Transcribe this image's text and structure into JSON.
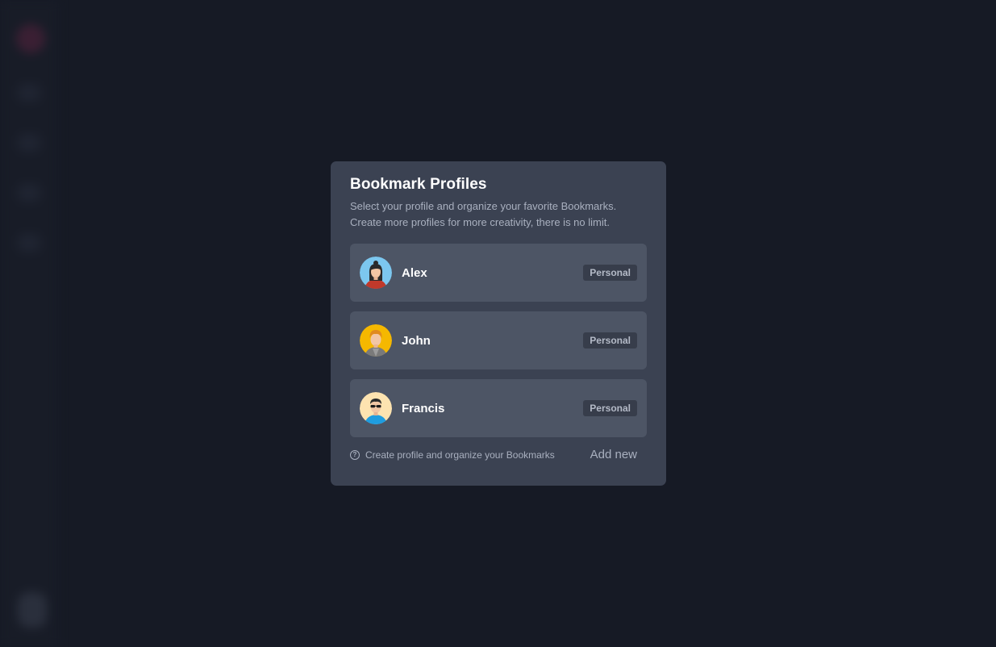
{
  "modal": {
    "title": "Bookmark Profiles",
    "subtitle_line1": "Select your profile and organize your favorite Bookmarks.",
    "subtitle_line2": "Create more profiles for more creativity, there is no limit."
  },
  "profiles": [
    {
      "name": "Alex",
      "badge": "Personal",
      "avatar": "woman-avatar-icon"
    },
    {
      "name": "John",
      "badge": "Personal",
      "avatar": "man-blond-avatar-icon"
    },
    {
      "name": "Francis",
      "badge": "Personal",
      "avatar": "man-sunglasses-avatar-icon"
    }
  ],
  "footer": {
    "help_text": "Create profile and organize your Bookmarks",
    "add_label": "Add new"
  },
  "colors": {
    "background": "#161a25",
    "modal": "#3b4252",
    "card": "#4d5565",
    "badge": "#373d4b"
  }
}
